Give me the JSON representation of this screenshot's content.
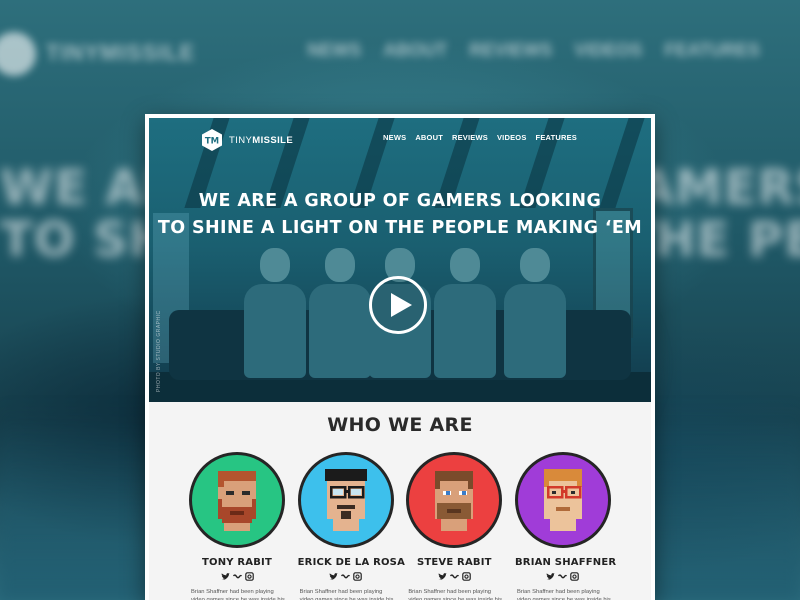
{
  "background": {
    "brand": "TINYMISSILE",
    "nav": [
      "NEWS",
      "ABOUT",
      "REVIEWS",
      "VIDEOS",
      "FEATURES"
    ],
    "headline_line1": "WE ARE A GROUP OF GAMERS LOOKING",
    "headline_line2": "TO SHINE A LIGHT ON THE PEOPLE MAKING ‘EM"
  },
  "header": {
    "brand_part1": "TINY",
    "brand_part2": "MISSILE",
    "logo_icon": "tm-hexagon-logo",
    "nav": [
      {
        "label": "NEWS"
      },
      {
        "label": "ABOUT"
      },
      {
        "label": "REVIEWS"
      },
      {
        "label": "VIDEOS"
      },
      {
        "label": "FEATURES"
      }
    ]
  },
  "hero": {
    "headline_line1": "WE ARE A GROUP OF GAMERS LOOKING",
    "headline_line2": "TO SHINE A LIGHT ON THE PEOPLE MAKING ‘EM",
    "play_icon": "play-icon",
    "photo_credit": "PHOTO BY STUDIO GRAPHIC"
  },
  "who_we_are": {
    "title": "WHO WE ARE",
    "members": [
      {
        "name": "TONY RABIT",
        "avatar_color": "#27c583",
        "bio": "Brian Shaffner had been playing video games since he was inside his"
      },
      {
        "name": "ERICK DE LA ROSA",
        "avatar_color": "#3dc0ec",
        "bio": "Brian Shaffner had been playing video games since he was inside his"
      },
      {
        "name": "STEVE RABIT",
        "avatar_color": "#ec4040",
        "bio": "Brian Shaffner had been playing video games since he was inside his"
      },
      {
        "name": "BRIAN SHAFFNER",
        "avatar_color": "#a03cd8",
        "bio": "Brian Shaffner had been playing video games since he was inside his"
      }
    ],
    "social_icons": [
      "twitter-icon",
      "vine-icon",
      "instagram-icon"
    ]
  },
  "colors": {
    "hero_tint": "#1e6e80",
    "text_dark": "#222222",
    "page_bg": "#f4f4f4"
  }
}
